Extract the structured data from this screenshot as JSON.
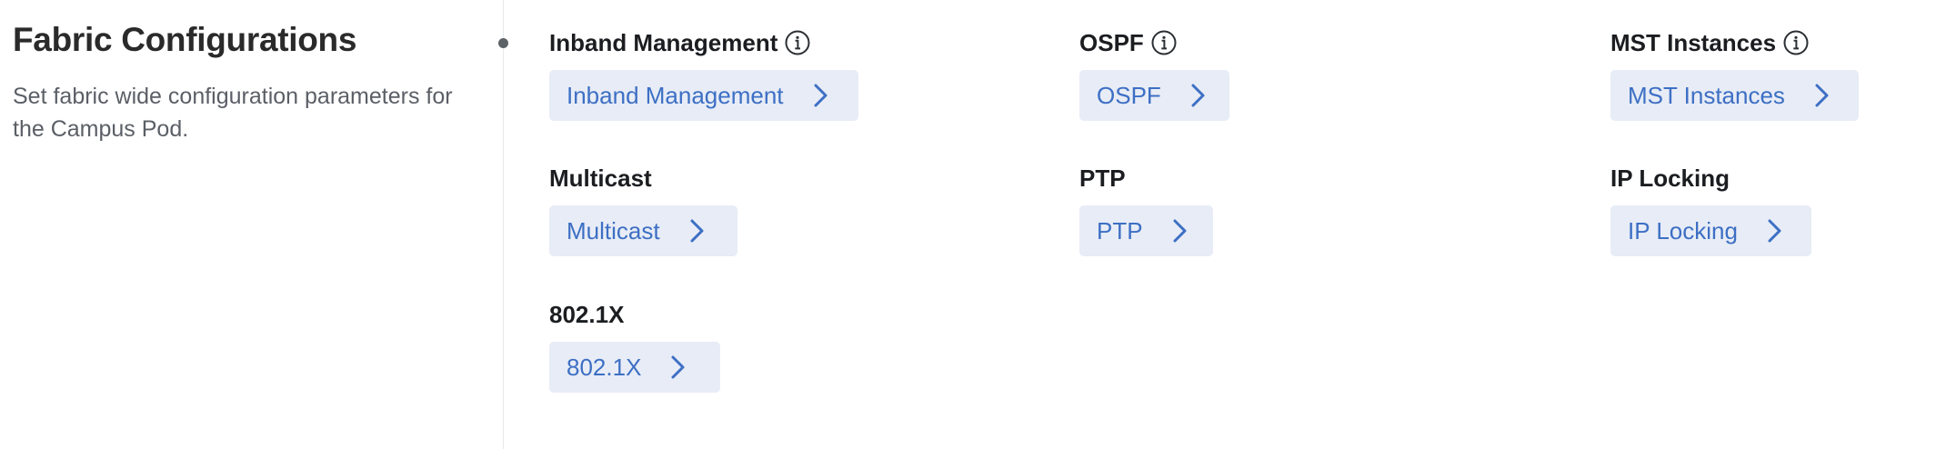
{
  "section": {
    "title": "Fabric Configurations",
    "description": "Set fabric wide configuration parameters for the Campus Pod."
  },
  "configs": [
    {
      "label": "Inband Management",
      "button_label": "Inband Management",
      "has_info": true
    },
    {
      "label": "OSPF",
      "button_label": "OSPF",
      "has_info": true
    },
    {
      "label": "MST Instances",
      "button_label": "MST Instances",
      "has_info": true
    },
    {
      "label": "Multicast",
      "button_label": "Multicast",
      "has_info": false
    },
    {
      "label": "PTP",
      "button_label": "PTP",
      "has_info": false
    },
    {
      "label": "IP Locking",
      "button_label": "IP Locking",
      "has_info": false
    },
    {
      "label": "802.1X",
      "button_label": "802.1X",
      "has_info": false
    }
  ],
  "icons": {
    "info": "info-icon",
    "chevron": "chevron-right-icon"
  },
  "colors": {
    "button_background": "#e7ecf6",
    "button_text": "#3d6fc4",
    "heading_text": "#1b1d20",
    "description_text": "#5b5f66"
  }
}
